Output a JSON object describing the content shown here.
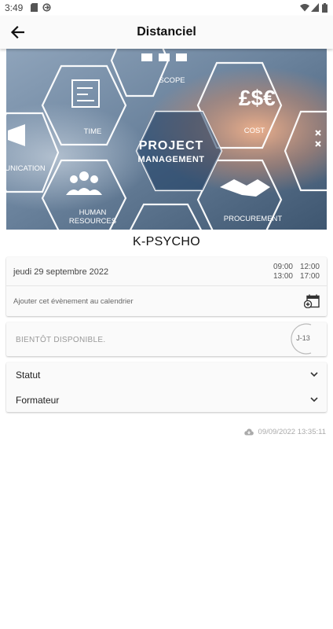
{
  "status_bar": {
    "time": "3:49"
  },
  "app_bar": {
    "title": "Distanciel"
  },
  "banner": {
    "center_line1": "PROJECT",
    "center_line2": "MANAGEMENT",
    "labels": {
      "scope": "SCOPE",
      "time": "TIME",
      "cost": "COST",
      "communication": "UNICATION",
      "human1": "HUMAN",
      "human2": "RESOURCES",
      "procurement": "PROCUREMENT"
    }
  },
  "event": {
    "title": "K-PSYCHO"
  },
  "date_card": {
    "date": "jeudi 29 septembre 2022",
    "times": [
      [
        "09:00",
        "12:00"
      ],
      [
        "13:00",
        "17:00"
      ]
    ],
    "calendar_label": "Ajouter cet évènement au calendrier"
  },
  "availability": {
    "text": "BIENTÔT DISPONIBLE.",
    "countdown": "J-13"
  },
  "accordion": {
    "status_label": "Statut",
    "trainer_label": "Formateur"
  },
  "sync": {
    "timestamp": "09/09/2022 13:35:11"
  }
}
